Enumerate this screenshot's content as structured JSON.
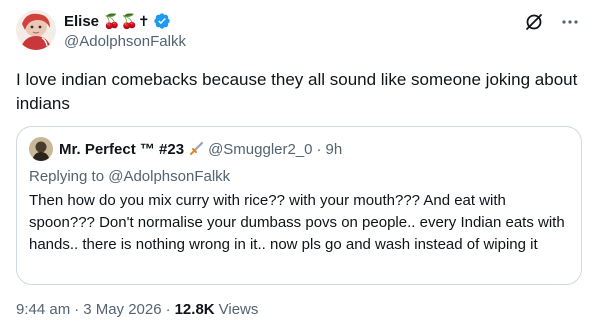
{
  "tweet": {
    "author": {
      "display_name": "Elise",
      "name_emoji": "🍒🍒✝",
      "handle": "@AdolphsonFalkk",
      "verified": true
    },
    "text": "I love indian comebacks because they all sound like someone joking about indians",
    "quote": {
      "author_name": "Mr. Perfect ™ #23",
      "author_emoji": "🗡",
      "handle": "@Smuggler2_0",
      "dot": "·",
      "time": "9h",
      "replying_prefix": "Replying to",
      "replying_to": "@AdolphsonFalkk",
      "text": "Then how do you mix curry with rice?? with your mouth??? And eat with spoon??? Don't normalise your dumbass povs on people.. every Indian eats with hands.. there is nothing wrong in it.. now pls go and wash instead of wiping it"
    },
    "meta": {
      "time": "9:44 am",
      "date": "3 May 2026",
      "views_count": "12.8K",
      "views_label": "Views",
      "separator": "·"
    }
  },
  "icons": {
    "grok": "grok-icon",
    "more": "more-icon",
    "verified": "verified-badge-icon",
    "sword": "dagger-icon"
  },
  "colors": {
    "text_primary": "#0f1419",
    "text_secondary": "#536471",
    "verified_blue": "#1d9bf0",
    "border": "#cfd9de"
  }
}
